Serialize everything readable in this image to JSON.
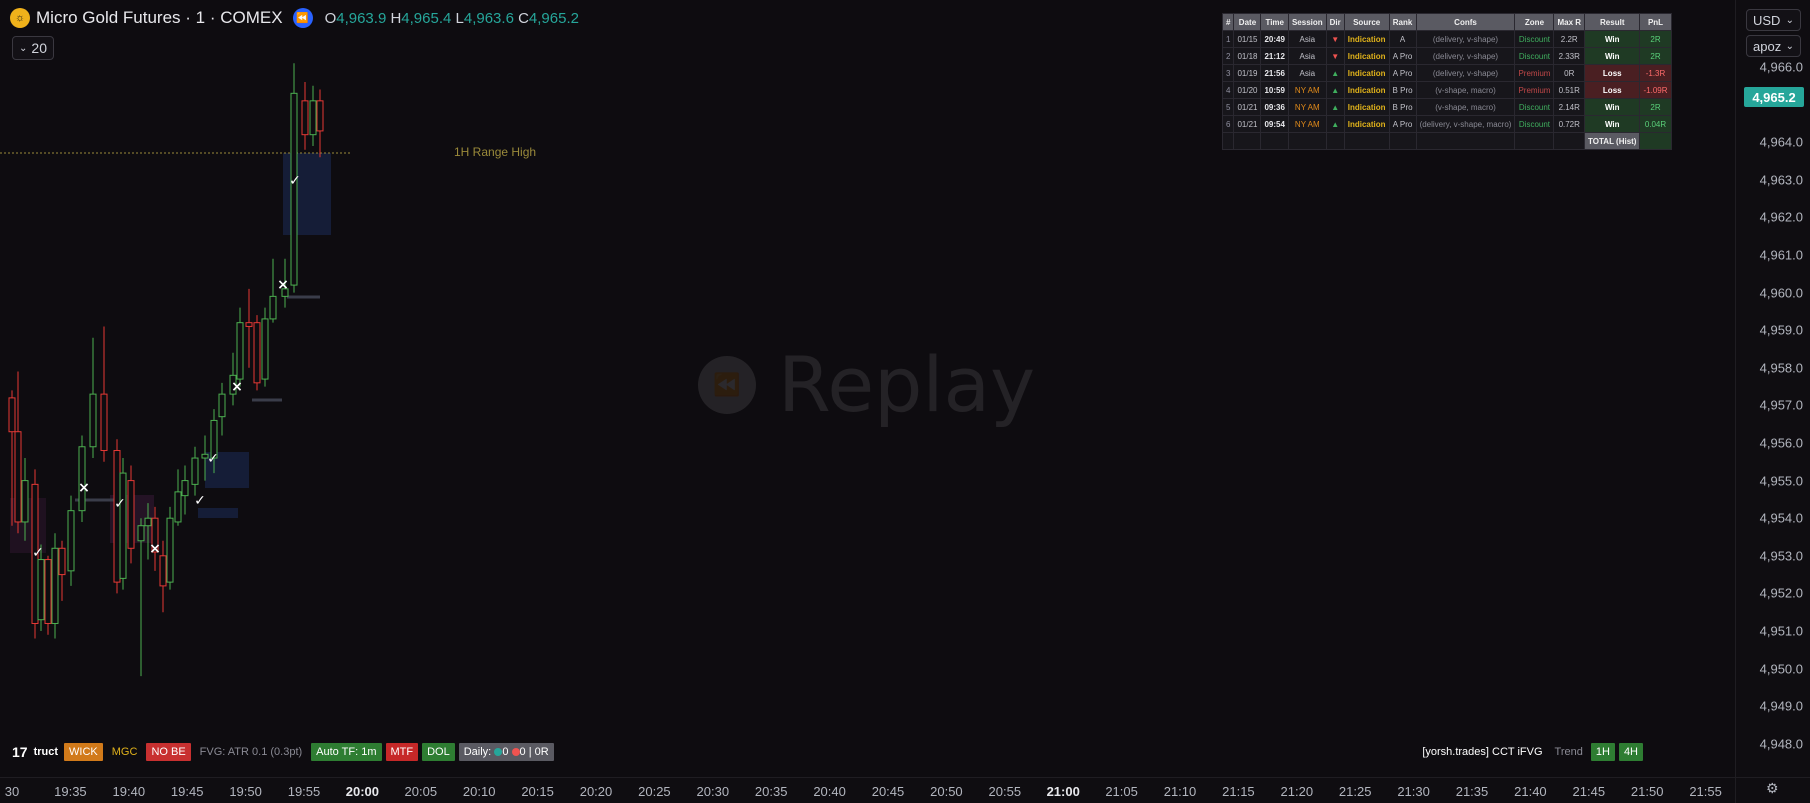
{
  "header": {
    "symbol": "Micro Gold Futures · 1 · COMEX",
    "open_key": "O",
    "open": "4,963.9",
    "high_key": "H",
    "high": "4,965.4",
    "low_key": "L",
    "low": "4,963.6",
    "close_key": "C",
    "close": "4,965.2",
    "interval": "20"
  },
  "top_right": {
    "currency": "USD",
    "user": "apoz"
  },
  "watermark": {
    "text": "Replay"
  },
  "range_label": "1H Range High",
  "price_axis": {
    "current": "4,965.2",
    "labels": [
      "4,966.0",
      "4,964.0",
      "4,963.0",
      "4,962.0",
      "4,961.0",
      "4,960.0",
      "4,959.0",
      "4,958.0",
      "4,957.0",
      "4,956.0",
      "4,955.0",
      "4,954.0",
      "4,953.0",
      "4,952.0",
      "4,951.0",
      "4,950.0",
      "4,949.0",
      "4,948.0"
    ]
  },
  "time_axis": {
    "labels": [
      "30",
      "19:35",
      "19:40",
      "19:45",
      "19:50",
      "19:55",
      "20:00",
      "20:05",
      "20:10",
      "20:15",
      "20:20",
      "20:25",
      "20:30",
      "20:35",
      "20:40",
      "20:45",
      "20:50",
      "20:55",
      "21:00",
      "21:05",
      "21:10",
      "21:15",
      "21:20",
      "21:25",
      "21:30",
      "21:35",
      "21:40",
      "21:45",
      "21:50",
      "21:55"
    ],
    "bold": [
      "20:00",
      "21:00"
    ]
  },
  "table": {
    "headers": [
      "#",
      "Date",
      "Time",
      "Session",
      "Dir",
      "Source",
      "Rank",
      "Confs",
      "Zone",
      "Max R",
      "Result",
      "PnL"
    ],
    "rows": [
      {
        "n": "1",
        "date": "01/15",
        "time": "20:49",
        "session": "Asia",
        "dir": "▼",
        "source": "Indication",
        "rank": "A",
        "confs": "(delivery, v-shape)",
        "zone": "Discount",
        "maxr": "2.2R",
        "result": "Win",
        "pnl": "2R"
      },
      {
        "n": "2",
        "date": "01/18",
        "time": "21:12",
        "session": "Asia",
        "dir": "▼",
        "source": "Indication",
        "rank": "A Pro",
        "confs": "(delivery, v-shape)",
        "zone": "Discount",
        "maxr": "2.33R",
        "result": "Win",
        "pnl": "2R"
      },
      {
        "n": "3",
        "date": "01/19",
        "time": "21:56",
        "session": "Asia",
        "dir": "▲",
        "source": "Indication",
        "rank": "A Pro",
        "confs": "(delivery, v-shape)",
        "zone": "Premium",
        "maxr": "0R",
        "result": "Loss",
        "pnl": "-1.3R"
      },
      {
        "n": "4",
        "date": "01/20",
        "time": "10:59",
        "session": "NY AM",
        "dir": "▲",
        "source": "Indication",
        "rank": "B Pro",
        "confs": "(v-shape, macro)",
        "zone": "Premium",
        "maxr": "0.51R",
        "result": "Loss",
        "pnl": "-1.09R"
      },
      {
        "n": "5",
        "date": "01/21",
        "time": "09:36",
        "session": "NY AM",
        "dir": "▲",
        "source": "Indication",
        "rank": "B Pro",
        "confs": "(v-shape, macro)",
        "zone": "Discount",
        "maxr": "2.14R",
        "result": "Win",
        "pnl": "2R"
      },
      {
        "n": "6",
        "date": "01/21",
        "time": "09:54",
        "session": "NY AM",
        "dir": "▲",
        "source": "Indication",
        "rank": "A Pro",
        "confs": "(delivery, v-shape, macro)",
        "zone": "Discount",
        "maxr": "0.72R",
        "result": "Win",
        "pnl": "0.04R"
      }
    ],
    "total_label": "TOTAL (Hist)"
  },
  "bottom_left": {
    "logo": "17",
    "struct": "truct",
    "wick": "WICK",
    "mgc": "MGC",
    "nobe": "NO BE",
    "fvg": "FVG: ATR 0.1 (0.3pt)",
    "autotf": "Auto TF: 1m",
    "mtf": "MTF",
    "dol": "DOL",
    "daily_label": "Daily:",
    "daily_win": "0",
    "daily_loss": "0",
    "daily_r": "| 0R"
  },
  "bottom_right": {
    "brand": "[yorsh.trades] CCT iFVG",
    "trend": "Trend",
    "tf1": "1H",
    "tf2": "4H"
  },
  "colors": {
    "up": "#26a69a",
    "down": "#ef5350",
    "bull_candle": "#4caf50",
    "bear_candle": "#e53935"
  }
}
